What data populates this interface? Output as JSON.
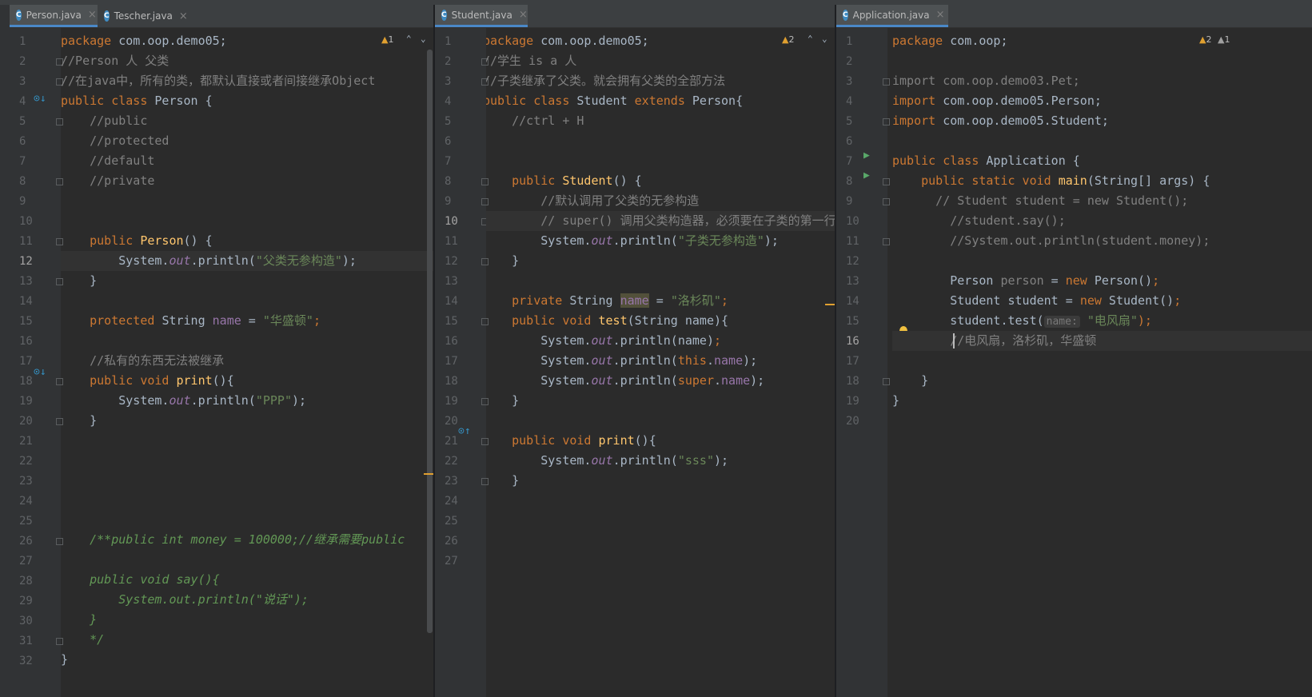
{
  "editor": {
    "panes": [
      {
        "tab": {
          "label": "Person.java",
          "icon": "class-file-icon"
        },
        "inactive_tabs": [
          {
            "label": "Tescher.java",
            "icon": "class-file-icon"
          }
        ],
        "warnings": {
          "warn_count": "1",
          "info_count": ""
        },
        "current_line": "12",
        "lines": [
          "1",
          "2",
          "3",
          "4",
          "5",
          "6",
          "7",
          "8",
          "9",
          "10",
          "11",
          "12",
          "13",
          "14",
          "15",
          "16",
          "17",
          "18",
          "19",
          "20",
          "21",
          "22",
          "23",
          "24",
          "25",
          "26",
          "27",
          "28",
          "29",
          "30",
          "31",
          "32"
        ]
      },
      {
        "tab": {
          "label": "Student.java",
          "icon": "class-file-icon"
        },
        "warnings": {
          "warn_count": "2",
          "info_count": ""
        },
        "current_line": "10",
        "lines": [
          "1",
          "2",
          "3",
          "4",
          "5",
          "6",
          "7",
          "8",
          "9",
          "10",
          "11",
          "12",
          "13",
          "14",
          "15",
          "16",
          "17",
          "18",
          "19",
          "20",
          "21",
          "22",
          "23",
          "24",
          "25",
          "26",
          "27"
        ]
      },
      {
        "tab": {
          "label": "Application.java",
          "icon": "class-file-icon"
        },
        "warnings": {
          "warn_count": "2",
          "info_count": "1"
        },
        "current_line": "16",
        "lines": [
          "1",
          "2",
          "3",
          "4",
          "5",
          "6",
          "7",
          "8",
          "9",
          "10",
          "11",
          "12",
          "13",
          "14",
          "15",
          "16",
          "17",
          "18",
          "19",
          "20"
        ]
      }
    ],
    "person_code": {
      "l1_kw": "package",
      "l1_rest": " com.oop.demo05;",
      "l2": "//Person 人 父类",
      "l3": "//在java中，所有的类，都默认直接或者间接继承Object",
      "l4_kw": "public class",
      "l4_rest": " Person {",
      "l5": "    //public",
      "l6": "    //protected",
      "l7": "    //default",
      "l8": "    //private",
      "l11_kw": "    public ",
      "l11_fn": "Person",
      "l11_rest": "() {",
      "l12_a": "        System.",
      "l12_out": "out",
      "l12_b": ".println(",
      "l12_str": "\"父类无参构造\"",
      "l12_c": ");",
      "l13": "    }",
      "l15_kw": "    protected ",
      "l15_a": "String ",
      "l15_fd": "name",
      "l15_b": " = ",
      "l15_str": "\"华盛顿\"",
      "l15_c": ";",
      "l17": "    //私有的东西无法被继承",
      "l18_kw": "    public void ",
      "l18_fn": "print",
      "l18_rest": "(){",
      "l19_a": "        System.",
      "l19_out": "out",
      "l19_b": ".println(",
      "l19_str": "\"PPP\"",
      "l19_c": ");",
      "l20": "    }",
      "l26": "    /**public int money = 100000;//继承需要public",
      "l28": "    public void say(){",
      "l29": "        System.out.println(\"说话\");",
      "l30": "    }",
      "l31": "    */",
      "l32": "}"
    },
    "student_code": {
      "l1_kw": "package",
      "l1_rest": " com.oop.demo05;",
      "l2": "//学生 is a 人",
      "l3": "//子类继承了父类。就会拥有父类的全部方法",
      "l4_kw": "public class",
      "l4_a": " Student ",
      "l4_kw2": "extends",
      "l4_b": " Person{",
      "l5": "    //ctrl + H",
      "l8_kw": "    public ",
      "l8_fn": "Student",
      "l8_rest": "() {",
      "l9": "        //默认调用了父类的无参构造",
      "l10": "        // super() 调用父类构造器，必须要在子类的第一行",
      "l11_a": "        System.",
      "l11_out": "out",
      "l11_b": ".println(",
      "l11_str": "\"子类无参构造\"",
      "l11_c": ");",
      "l12": "    }",
      "l14_kw": "    private ",
      "l14_a": "String ",
      "l14_fd": "name",
      "l14_b": " = ",
      "l14_str": "\"洛杉矶\"",
      "l14_c": ";",
      "l15_kw": "    public void ",
      "l15_fn": "test",
      "l15_rest": "(String name){",
      "l16_a": "        System.",
      "l16_out": "out",
      "l16_b": ".println(name)",
      "l16_c": ";",
      "l17_a": "        System.",
      "l17_out": "out",
      "l17_b": ".println(",
      "l17_kw": "this",
      "l17_dot": ".",
      "l17_fd": "name",
      "l17_c": ");",
      "l18_a": "        System.",
      "l18_out": "out",
      "l18_b": ".println(",
      "l18_kw": "super",
      "l18_dot": ".",
      "l18_fd": "name",
      "l18_c": ");",
      "l19": "    }",
      "l21_kw": "    public void ",
      "l21_fn": "print",
      "l21_rest": "(){",
      "l22_a": "        System.",
      "l22_out": "out",
      "l22_b": ".println(",
      "l22_str": "\"sss\"",
      "l22_c": ");",
      "l23": "    }"
    },
    "app_code": {
      "l1_kw": "package",
      "l1_rest": " com.oop;",
      "l3_kw": "import",
      "l3_rest": " com.oop.demo03.Pet;",
      "l4_kw": "import",
      "l4_rest": " com.oop.demo05.Person;",
      "l5_kw": "import",
      "l5_rest": " com.oop.demo05.Student;",
      "l7_kw": "public class",
      "l7_rest": " Application {",
      "l8_kw": "    public static void ",
      "l8_fn": "main",
      "l8_rest": "(String[] args) {",
      "l9": "      // Student student = new Student();",
      "l10": "        //student.say();",
      "l11": "        //System.out.println(student.money);",
      "l13_a": "        Person ",
      "l13_var": "person",
      "l13_b": " = ",
      "l13_kw": "new",
      "l13_c": " Person()",
      "l13_d": ";",
      "l14_a": "        Student student = ",
      "l14_kw": "new",
      "l14_c": " Student()",
      "l14_d": ";",
      "l15_a": "        student.test(",
      "l15_hint": "name:",
      "l15_str": " \"电风扇\"",
      "l15_c": ");",
      "l16": "        //电风扇，洛杉矶，华盛顿",
      "l18": "    }",
      "l19": "}"
    }
  }
}
